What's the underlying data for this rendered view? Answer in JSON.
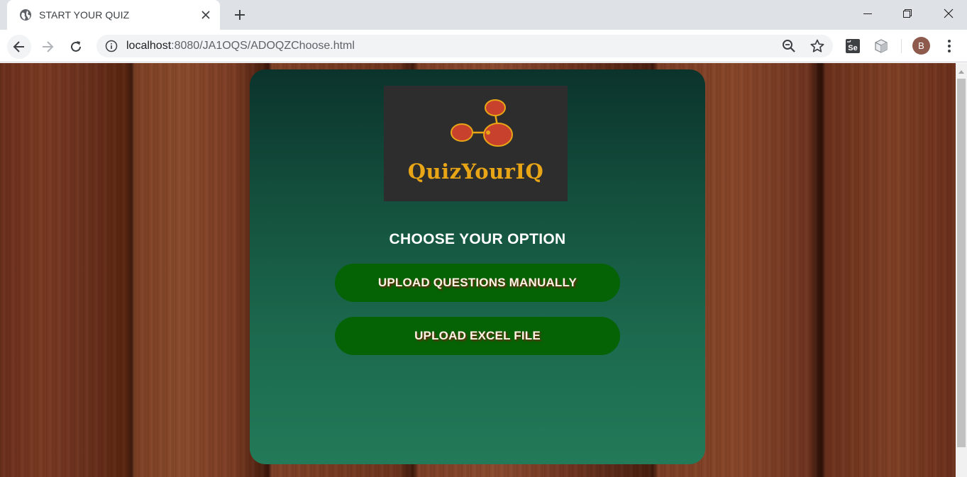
{
  "browser": {
    "tab_title": "START YOUR QUIZ",
    "url_host": "localhost",
    "url_path": ":8080/JA1OQS/ADOQZChoose.html",
    "avatar_letter": "B",
    "icons": [
      "globe-icon",
      "close-icon",
      "plus-icon",
      "minimize-icon",
      "restore-icon",
      "window-close-icon",
      "back-arrow-icon",
      "forward-arrow-icon",
      "reload-icon",
      "info-icon",
      "zoom-out-icon",
      "star-icon",
      "selenium-extension-icon",
      "cube-extension-icon",
      "kebab-menu-icon"
    ]
  },
  "page": {
    "logo_text": "QuizYourIQ",
    "heading": "CHOOSE YOUR OPTION",
    "buttons": {
      "manual": "UPLOAD QUESTIONS MANUALLY",
      "excel": "UPLOAD EXCEL FILE"
    }
  },
  "colors": {
    "card_top": "#0b332c",
    "card_bottom": "#227a58",
    "button_bg": "#056205",
    "logo_text": "#e8a516",
    "logo_node": "#c8412c"
  }
}
